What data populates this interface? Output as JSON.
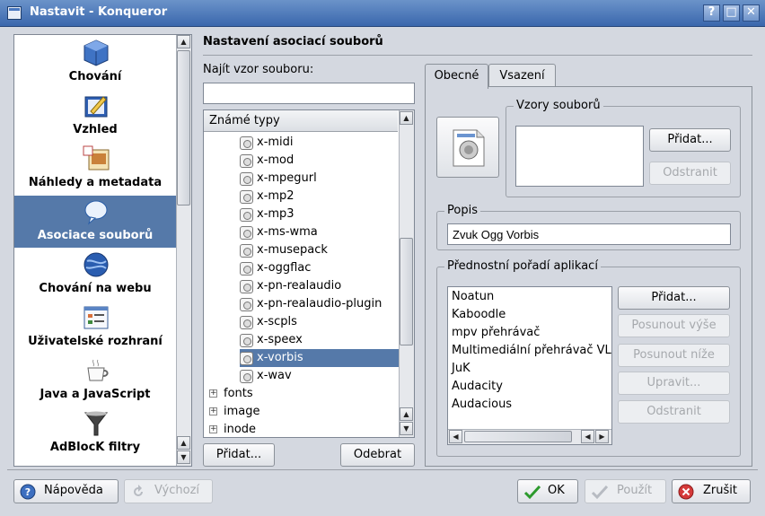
{
  "window": {
    "title": "Nastavit - Konqueror",
    "buttons": [
      "?",
      "□",
      "✕"
    ]
  },
  "sidebar": {
    "items": [
      {
        "label": "Chování",
        "icon": "cube-behaviour-icon",
        "active": false
      },
      {
        "label": "Vzhled",
        "icon": "paint-appearance-icon",
        "active": false
      },
      {
        "label": "Náhledy a metadata",
        "icon": "preview-metadata-icon",
        "active": false
      },
      {
        "label": "Asociace souborů",
        "icon": "file-association-icon",
        "active": true
      },
      {
        "label": "Chování na webu",
        "icon": "globe-icon",
        "active": false
      },
      {
        "label": "Uživatelské rozhraní",
        "icon": "user-interface-icon",
        "active": false
      },
      {
        "label": "Java a JavaScript",
        "icon": "java-cup-icon",
        "active": false
      },
      {
        "label": "AdBlocK filtry",
        "icon": "funnel-filter-icon",
        "active": false
      }
    ]
  },
  "main": {
    "heading": "Nastavení asociací souborů",
    "search_label": "Najít vzor souboru:",
    "search_value": "",
    "tree": {
      "header": "Známé typy",
      "items": [
        "x-midi",
        "x-mod",
        "x-mpegurl",
        "x-mp2",
        "x-mp3",
        "x-ms-wma",
        "x-musepack",
        "x-oggflac",
        "x-pn-realaudio",
        "x-pn-realaudio-plugin",
        "x-scpls",
        "x-speex",
        "x-vorbis",
        "x-wav"
      ],
      "selected": "x-vorbis",
      "groups": [
        "fonts",
        "image",
        "inode"
      ]
    },
    "add_button": "Přidat...",
    "remove_button": "Odebrat"
  },
  "tabs": {
    "general": "Obecné",
    "embedding": "Vsazení"
  },
  "general": {
    "patterns_group": "Vzory souborů",
    "patterns_add": "Přidat...",
    "patterns_remove": "Odstranit",
    "description_group": "Popis",
    "description_value": "Zvuk Ogg Vorbis",
    "apps_group": "Přednostní pořadí aplikací",
    "apps": [
      "Noatun",
      "Kaboodle",
      "mpv přehrávač",
      "Multimediální přehrávač VL",
      "JuK",
      "Audacity",
      "Audacious"
    ],
    "apps_add": "Přidat...",
    "apps_up": "Posunout výše",
    "apps_down": "Posunout níže",
    "apps_edit": "Upravit...",
    "apps_remove": "Odstranit"
  },
  "footer": {
    "help": "Nápověda",
    "defaults": "Výchozí",
    "ok": "OK",
    "apply": "Použít",
    "cancel": "Zrušit"
  }
}
